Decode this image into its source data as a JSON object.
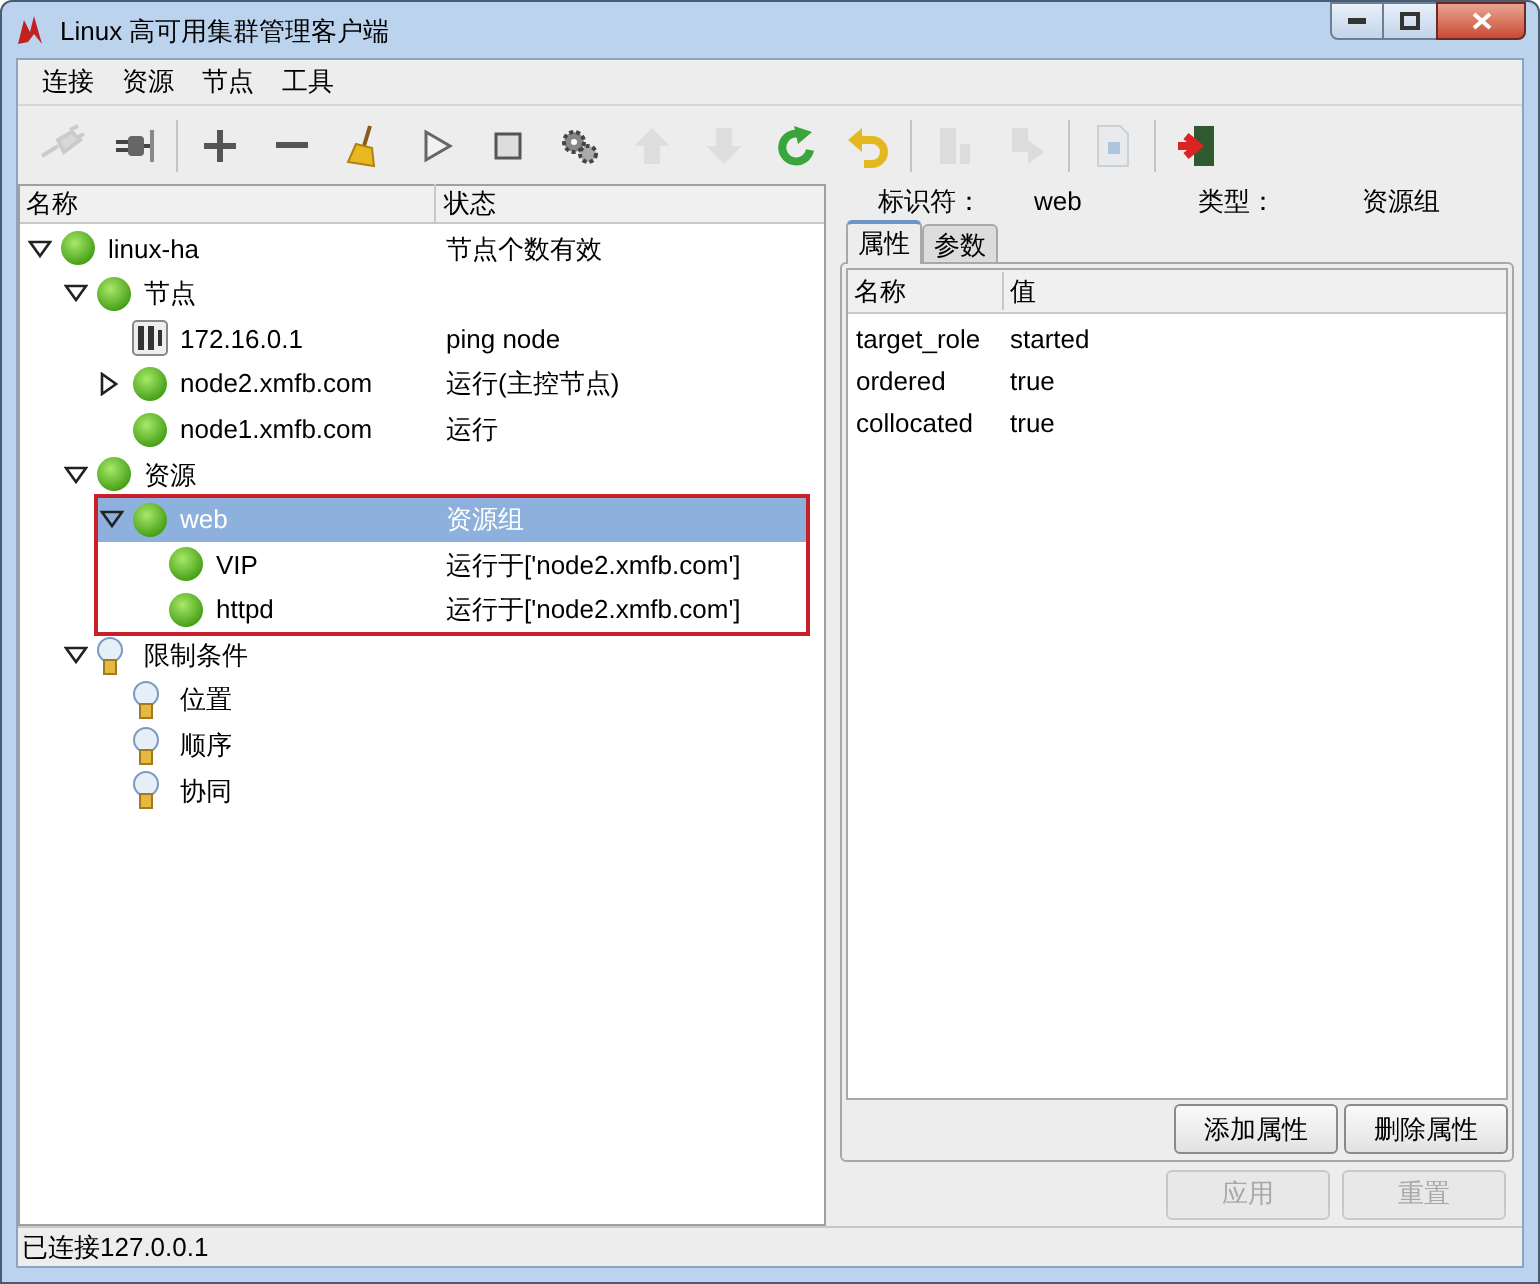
{
  "window": {
    "title": "Linux 高可用集群管理客户端"
  },
  "menu": [
    {
      "label": "连接"
    },
    {
      "label": "资源"
    },
    {
      "label": "节点"
    },
    {
      "label": "工具"
    }
  ],
  "toolbar": [
    {
      "disabled": true
    },
    {
      "disabled": false
    },
    {
      "disabled": false
    },
    {
      "disabled": false
    },
    {
      "disabled": false
    },
    {
      "disabled": false
    },
    {
      "disabled": false
    },
    {
      "disabled": false
    },
    {
      "disabled": true
    },
    {
      "disabled": true
    },
    {
      "disabled": false
    },
    {
      "disabled": false
    },
    {
      "disabled": true
    },
    {
      "disabled": true
    },
    {
      "disabled": true
    },
    {
      "disabled": false
    }
  ],
  "tree": {
    "columns": [
      "名称",
      "状态"
    ],
    "nodes": [
      {
        "kind": "dot",
        "name": "linux-ha",
        "status": "节点个数有效",
        "expanded": true,
        "selected": false,
        "children": [
          {
            "kind": "dot",
            "name": "节点",
            "expanded": true,
            "selected": false,
            "children": [
              {
                "kind": "host",
                "name": "172.16.0.1",
                "status": "ping node",
                "selected": false
              },
              {
                "kind": "dot",
                "name": "node2.xmfb.com",
                "status": "运行(主控节点)",
                "expanded": false,
                "selected": false
              },
              {
                "kind": "dot",
                "name": "node1.xmfb.com",
                "status": "运行",
                "selected": false
              }
            ]
          },
          {
            "kind": "dot",
            "name": "资源",
            "expanded": true,
            "selected": false,
            "children": [
              {
                "kind": "dot",
                "name": "web",
                "status": "资源组",
                "expanded": true,
                "selected": true,
                "highlighted": true,
                "children": [
                  {
                    "kind": "dot",
                    "name": "VIP",
                    "status": "运行于['node2.xmfb.com']",
                    "selected": false
                  },
                  {
                    "kind": "dot",
                    "name": "httpd",
                    "status": "运行于['node2.xmfb.com']",
                    "selected": false
                  }
                ]
              }
            ]
          },
          {
            "kind": "bulb",
            "name": "限制条件",
            "expanded": true,
            "selected": false,
            "children": [
              {
                "kind": "bulb",
                "name": "位置",
                "selected": false
              },
              {
                "kind": "bulb",
                "name": "顺序",
                "selected": false
              },
              {
                "kind": "bulb",
                "name": "协同",
                "selected": false
              }
            ]
          }
        ]
      }
    ]
  },
  "details": {
    "id_label": "标识符：",
    "id_value": "web",
    "type_label": "类型：",
    "type_value": "资源组",
    "tabs": [
      {
        "label": "属性",
        "selected": true
      },
      {
        "label": "参数",
        "selected": false
      }
    ],
    "columns": [
      "名称",
      "值"
    ],
    "rows": [
      {
        "name": "target_role",
        "value": "started"
      },
      {
        "name": "ordered",
        "value": "true"
      },
      {
        "name": "collocated",
        "value": "true"
      }
    ],
    "buttons": [
      {
        "label": "添加属性",
        "disabled": false
      },
      {
        "label": "删除属性",
        "disabled": false
      }
    ],
    "footer_buttons": [
      {
        "label": "应用",
        "disabled": true
      },
      {
        "label": "重置",
        "disabled": true
      }
    ]
  },
  "status_bar": "已连接127.0.0.1"
}
